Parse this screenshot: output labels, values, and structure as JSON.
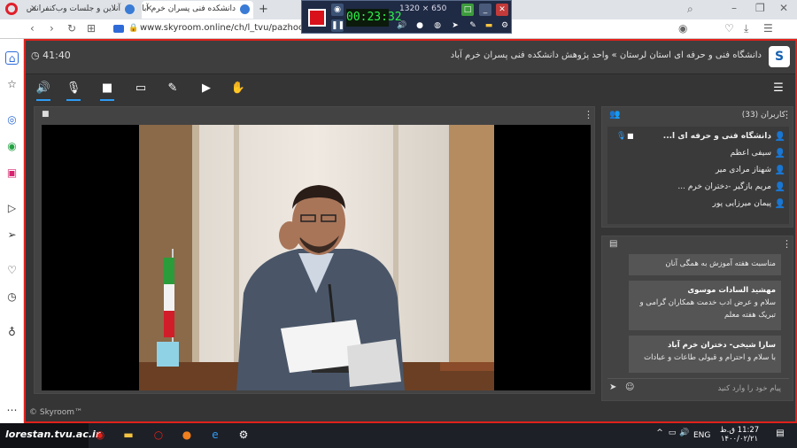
{
  "browser": {
    "tabs": [
      {
        "label": "آنلاین و جلسات وب‌کنفرانس",
        "active": false
      },
      {
        "label": "دانشکده فنی پسران خرم آباد",
        "active": true
      }
    ],
    "new_tab_label": "+",
    "url": "www.skyroom.online/ch/l_tvu/pazhoohesh"
  },
  "recorder": {
    "timer": "00:23:32",
    "size": "1320 × 650"
  },
  "app": {
    "title": "دانشگاه فنی و حرفه ای استان لرستان » واحد پژوهش دانشکده فنی پسران خرم آباد",
    "logo": "S",
    "session_time": "41:40",
    "copyright": "© Skyroom™"
  },
  "toolbar": {
    "icons": [
      "speaker-icon",
      "mic-icon",
      "camera-icon",
      "screen-share-icon",
      "whiteboard-icon",
      "media-icon",
      "raise-hand-icon",
      "menu-icon"
    ]
  },
  "users": {
    "header": "کاربران (33)",
    "list": [
      {
        "name": "دانشگاه فنی و حرفه ای ا...",
        "role": "presenter",
        "color": "#2e9cf5"
      },
      {
        "name": "سیفی اعظم",
        "role": "user",
        "color": "#2e9cf5"
      },
      {
        "name": "شهناز مرادی میر",
        "role": "user",
        "color": "#f2c200"
      },
      {
        "name": "مریم بازگیر -دختران خرم ...",
        "role": "user",
        "color": "#f2c200"
      },
      {
        "name": "پیمان میرزایی پور",
        "role": "user",
        "color": "#f2c200"
      }
    ]
  },
  "chat": {
    "messages": [
      {
        "sender": "",
        "text": "مناسبت هفته آموزش به همگی آنان"
      },
      {
        "sender": "مهشید السادات موسوی",
        "text": "سلام و عرض ادب خدمت همکاران گرامی و تبریک هفته معلم"
      },
      {
        "sender": "سارا شیخی- دختران خرم آباد",
        "text": "با سلام و احترام و قبولی طاعات و عبادات"
      }
    ],
    "input_placeholder": "پیام خود را وارد کنید"
  },
  "taskbar": {
    "brand": "lorestan.tvu.ac.ir",
    "lang": "ENG",
    "time": "11:27 ق.ظ",
    "date": "۱۴۰۰/۰۲/۲۱"
  }
}
